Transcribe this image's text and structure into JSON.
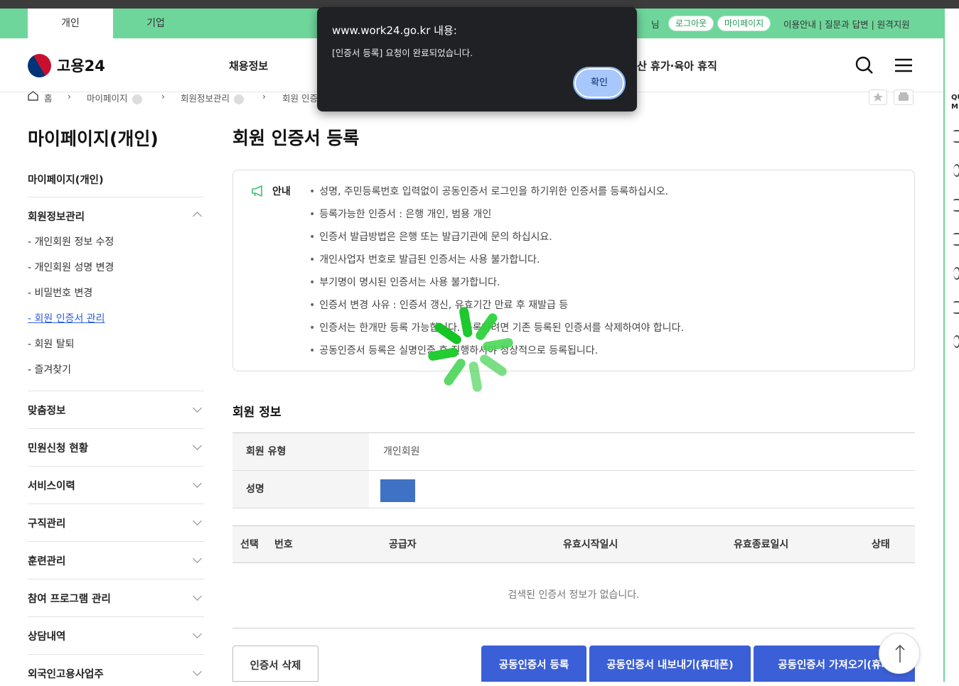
{
  "header": {
    "tabs": [
      "개인",
      "기업"
    ],
    "util_name_suffix": "님",
    "logout_label": "로그아웃",
    "mypage_label": "마이페이지",
    "util_links": "이용안내 | 질문과 답변 | 원격지원",
    "logo_text": "고용24",
    "gnb_items": [
      "채용정보",
      "산 휴가·육아 휴직"
    ]
  },
  "breadcrumb": [
    "홈",
    "마이페이지",
    "회원정보관리",
    "회원 인증"
  ],
  "quick_menu_label": [
    "QU",
    "MI"
  ],
  "sidebar": {
    "title": "마이페이지(개인)",
    "home": "마이페이지(개인)",
    "open_section": "회원정보관리",
    "sub_items": [
      "- 개인회원 정보 수정",
      "- 개인회원 성명 변경",
      "- 비밀번호 변경",
      "- 회원 인증서 관리",
      "- 회원 탈퇴",
      "- 즐겨찾기"
    ],
    "sections": [
      "맞춤정보",
      "민원신청 현황",
      "서비스이력",
      "구직관리",
      "훈련관리",
      "참여 프로그램 관리",
      "상담내역",
      "외국인고용사업주"
    ]
  },
  "main": {
    "title": "회원 인증서 등록",
    "notice_label": "안내",
    "notice_items": [
      "성명, 주민등록번호 입력없이 공동인증서 로그인을 하기위한 인증서를 등록하십시오.",
      "등록가능한 인증서 : 은행 개인, 범용 개인",
      "인증서 발급방법은 은행 또는 발급기관에 문의 하십시요.",
      "개인사업자 번호로 발급된 인증서는 사용 불가합니다.",
      "부기명이 명시된 인증서는 사용 불가합니다.",
      "인증서 변경 사유 : 인증서 갱신, 유효기간 만료 후 재발급 등",
      "인증서는 한개만 등록 가능합니다. 등록하려면 기존 등록된 인증서를 삭제하여야 합니다.",
      "공동인증서 등록은 실명인증 후 진행하셔야 정상적으로 등록됩니다."
    ],
    "member_info_title": "회원 정보",
    "member_type_label": "회원 유형",
    "member_type_value": "개인회원",
    "name_label": "성명",
    "list_headers": [
      "선택",
      "번호",
      "공급자",
      "유효시작일시",
      "유효종료일시",
      "상태"
    ],
    "empty_message": "검색된 인증서 정보가 없습니다.",
    "buttons": {
      "delete": "인증서 삭제",
      "register": "공동인증서 등록",
      "export": "공동인증서 내보내기(휴대폰)",
      "import": "공동인증서 가져오기(휴대"
    }
  },
  "dialog": {
    "title": "www.work24.go.kr 내용:",
    "message": "[인증서 등록] 요청이 완료되었습니다.",
    "ok_label": "확인"
  },
  "colors": {
    "brand_green": "#6fd69b",
    "button_blue": "#3b5fd6",
    "link_blue": "#2f5fd7",
    "dialog_bg": "#202124"
  }
}
